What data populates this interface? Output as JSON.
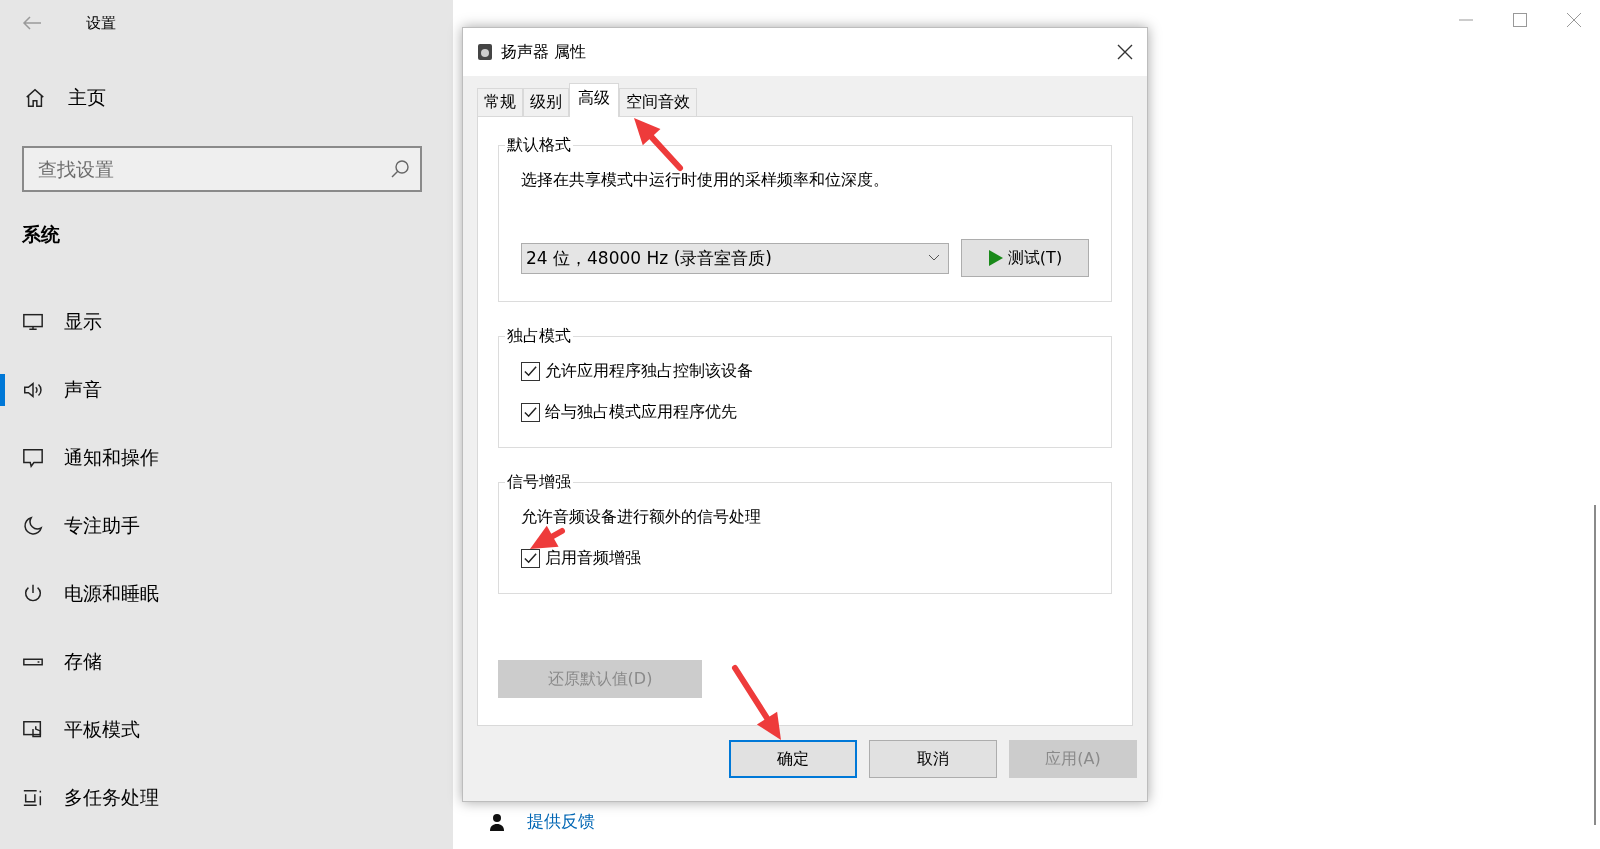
{
  "settings": {
    "title": "设置",
    "home": "主页",
    "search": {
      "placeholder": "查找设置"
    },
    "section": "系统",
    "items": [
      {
        "label": "显示",
        "selected": false
      },
      {
        "label": "声音",
        "selected": true
      },
      {
        "label": "通知和操作",
        "selected": false
      },
      {
        "label": "专注助手",
        "selected": false
      },
      {
        "label": "电源和睡眠",
        "selected": false
      },
      {
        "label": "存储",
        "selected": false
      },
      {
        "label": "平板模式",
        "selected": false
      },
      {
        "label": "多任务处理",
        "selected": false
      }
    ],
    "feedback_link": "提供反馈"
  },
  "dialog": {
    "title": "扬声器 属性",
    "tabs": [
      {
        "label": "常规",
        "selected": false
      },
      {
        "label": "级别",
        "selected": false
      },
      {
        "label": "高级",
        "selected": true
      },
      {
        "label": "空间音效",
        "selected": false
      }
    ],
    "groups": [
      {
        "title": "默认格式",
        "description": "选择在共享模式中运行时使用的采样频率和位深度。",
        "select": {
          "value": "24 位，48000 Hz (录音室音质)"
        },
        "test_button": "测试(T)"
      },
      {
        "title": "独占模式",
        "checkboxes": [
          {
            "label": "允许应用程序独占控制该设备",
            "checked": true
          },
          {
            "label": "给与独占模式应用程序优先",
            "checked": true
          }
        ]
      },
      {
        "title": "信号增强",
        "description": "允许音频设备进行额外的信号处理",
        "checkboxes": [
          {
            "label": "启用音频增强",
            "checked": true
          }
        ]
      }
    ],
    "restore_button": {
      "label": "还原默认值(D)",
      "disabled": true
    },
    "buttons": [
      {
        "label": "确定",
        "kind": "default",
        "disabled": false
      },
      {
        "label": "取消",
        "kind": "normal",
        "disabled": false
      },
      {
        "label": "应用(A)",
        "kind": "normal",
        "disabled": true
      }
    ]
  }
}
